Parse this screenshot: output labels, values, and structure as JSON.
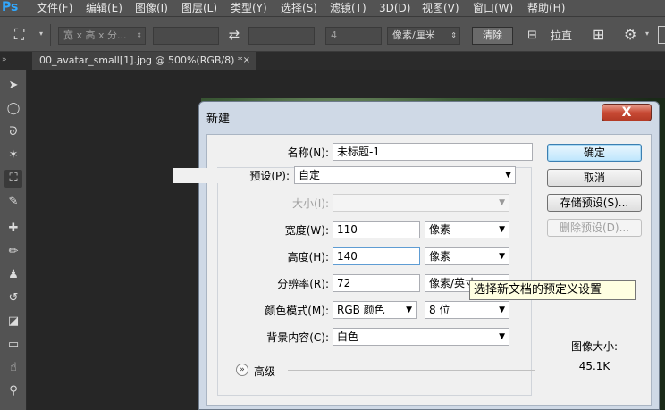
{
  "app": {
    "logo": "Ps"
  },
  "menu": [
    "文件(F)",
    "编辑(E)",
    "图像(I)",
    "图层(L)",
    "类型(Y)",
    "选择(S)",
    "滤镜(T)",
    "3D(D)",
    "视图(V)",
    "窗口(W)",
    "帮助(H)"
  ],
  "options_bar": {
    "tool_icon": "crop-icon",
    "ratio_select": "宽 x 高 x 分...",
    "resolution_value": "4",
    "unit_select": "像素/厘米",
    "clear_button": "清除",
    "straighten_label": "拉直"
  },
  "document_tab": {
    "title": "00_avatar_small[1].jpg @ 500%(RGB/8) *",
    "close": "×"
  },
  "dialog": {
    "title": "新建",
    "close": "X",
    "name_label": "名称(N):",
    "name_value": "未标题-1",
    "preset_label": "预设(P):",
    "preset_value": "自定",
    "size_label": "大小(I):",
    "size_value": "",
    "width_label": "宽度(W):",
    "width_value": "110",
    "width_unit": "像素",
    "height_label": "高度(H):",
    "height_value": "140",
    "height_unit": "像素",
    "resolution_label": "分辨率(R):",
    "resolution_value": "72",
    "resolution_unit": "像素/英寸",
    "color_mode_label": "颜色模式(M):",
    "color_mode_value": "RGB 颜色",
    "bit_depth_value": "8 位",
    "background_label": "背景内容(C):",
    "background_value": "白色",
    "advanced_label": "高级",
    "buttons": {
      "ok": "确定",
      "cancel": "取消",
      "save_preset": "存储预设(S)...",
      "delete_preset": "删除预设(D)..."
    },
    "image_size_label": "图像大小:",
    "image_size_value": "45.1K",
    "tooltip": "选择新文档的预定义设置"
  }
}
